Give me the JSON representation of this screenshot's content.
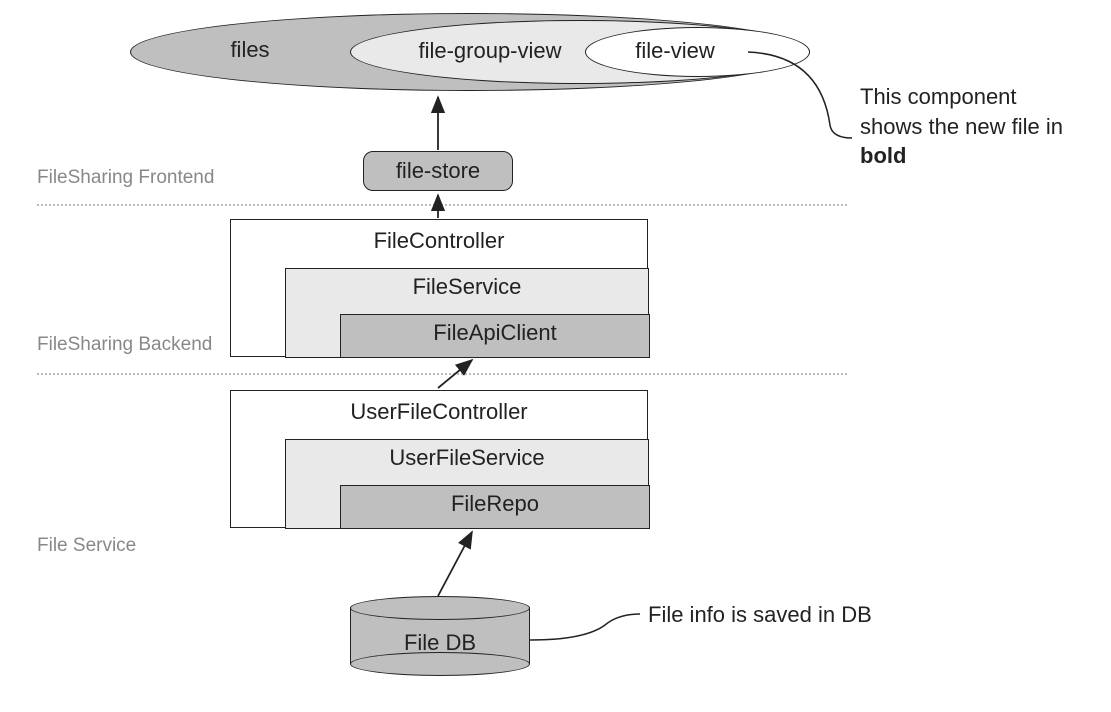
{
  "sections": {
    "frontend": "FileSharing Frontend",
    "backend": "FileSharing Backend",
    "fileservice": "File Service"
  },
  "ellipses": {
    "files": "files",
    "fileGroupView": "file-group-view",
    "fileView": "file-view"
  },
  "fileStore": "file-store",
  "backendBox": {
    "controller": "FileController",
    "service": "FileService",
    "client": "FileApiClient"
  },
  "serviceBox": {
    "controller": "UserFileController",
    "service": "UserFileService",
    "repo": "FileRepo"
  },
  "db": "File DB",
  "annotations": {
    "fileView_pre": "This component shows the new file in ",
    "fileView_bold": "bold",
    "db": "File info is saved in DB"
  }
}
